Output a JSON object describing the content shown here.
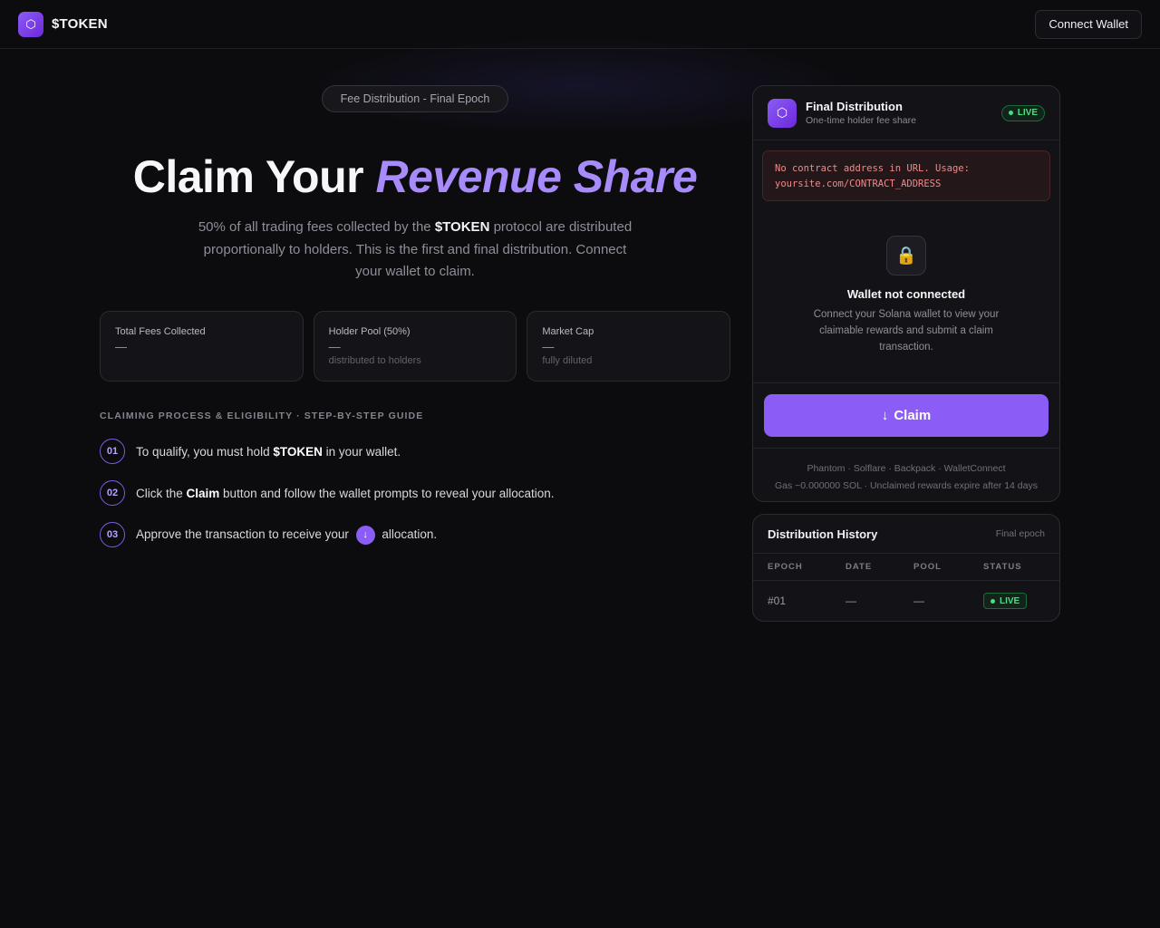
{
  "header": {
    "logo_glyph": "⬡",
    "brand": "$TOKEN",
    "connect_label": "Connect Wallet"
  },
  "hero": {
    "badge": "Fee Distribution - Final Epoch",
    "title_plain": "Claim Your ",
    "title_accent": "Revenue Share",
    "sub_before": "50% of all trading fees collected by the ",
    "sub_token": "$TOKEN",
    "sub_after": " protocol are distributed proportionally to holders. This is the first and final distribution. Connect your wallet to claim."
  },
  "stats": [
    {
      "label": "Total Fees Collected",
      "value": "—",
      "note": ""
    },
    {
      "label": "Holder Pool (50%)",
      "value": "—",
      "note": "distributed to holders"
    },
    {
      "label": "Market Cap",
      "value": "—",
      "note": "fully diluted"
    }
  ],
  "guide": {
    "title": "CLAIMING PROCESS & ELIGIBILITY · STEP-BY-STEP GUIDE",
    "steps": [
      {
        "num": "01",
        "before": "To qualify, you must hold ",
        "bold": "$TOKEN",
        "after": " in your wallet."
      },
      {
        "num": "02",
        "before": "Click the ",
        "bold": "Claim",
        "after": " button and follow the wallet prompts to reveal your allocation."
      },
      {
        "num": "03",
        "before": "Approve the transaction to receive your ",
        "icon": "↓",
        "after": " allocation."
      }
    ]
  },
  "claim_card": {
    "logo_glyph": "⬡",
    "title": "Final Distribution",
    "subtitle": "One-time holder fee share",
    "live_label": "LIVE",
    "error_line1": "No contract address in URL. Usage:",
    "error_line2": "yoursite.com/CONTRACT_ADDRESS",
    "lock_glyph": "🔒",
    "wallet_title": "Wallet not connected",
    "wallet_text": "Connect your Solana wallet to view your claimable rewards and submit a claim transaction.",
    "claim_icon": "↓",
    "claim_label": "Claim",
    "wallets": "Phantom · Solflare · Backpack · WalletConnect",
    "gas_note": "Gas ~0.000000 SOL · Unclaimed rewards expire after 14 days"
  },
  "history": {
    "title": "Distribution History",
    "note": "Final epoch",
    "columns": [
      "EPOCH",
      "DATE",
      "POOL",
      "STATUS"
    ],
    "rows": [
      {
        "epoch": "#01",
        "date": "—",
        "pool": "—",
        "status": "LIVE"
      }
    ]
  },
  "colors": {
    "accent": "#8b5cf6",
    "accent_text": "#a78bfa",
    "live_green": "#4ade80",
    "error_red": "#f08a8a",
    "background": "#0c0c0f"
  }
}
